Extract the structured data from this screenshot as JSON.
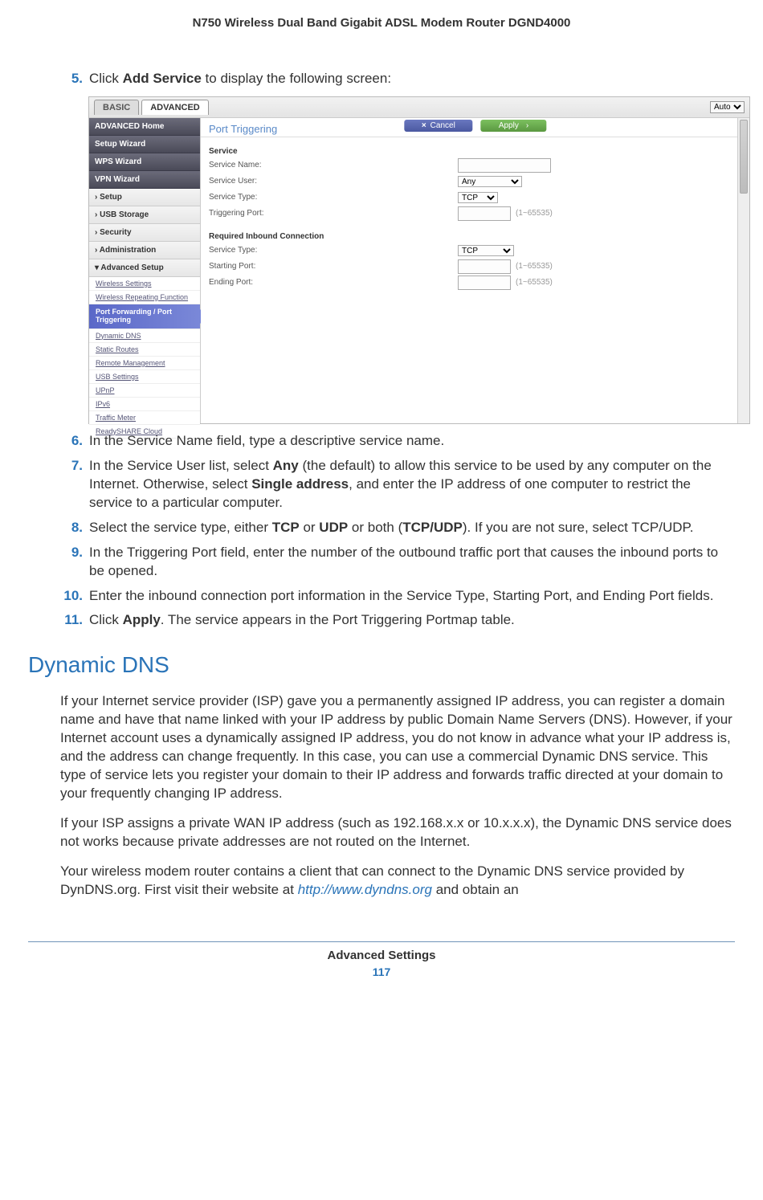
{
  "header": {
    "title": "N750 Wireless Dual Band Gigabit ADSL Modem Router DGND4000"
  },
  "steps": {
    "s5": {
      "num": "5.",
      "text_a": "Click ",
      "b1": "Add Service",
      "text_b": " to display the following screen:"
    },
    "s6": {
      "num": "6.",
      "text": "In the Service Name field, type a descriptive service name."
    },
    "s7": {
      "num": "7.",
      "a": "In the Service User list, select ",
      "b1": "Any",
      "b": " (the default) to allow this service to be used by any computer on the Internet. Otherwise, select ",
      "b2": "Single address",
      "c": ", and enter the IP address of one computer to restrict the service to a particular computer."
    },
    "s8": {
      "num": "8.",
      "a": "Select the service type, either ",
      "b1": "TCP",
      "b": " or ",
      "b2": "UDP",
      "c": " or both (",
      "b3": "TCP/UDP",
      "d": "). If you are not sure, select TCP/UDP."
    },
    "s9": {
      "num": "9.",
      "text": "In the Triggering Port field, enter the number of the outbound traffic port that causes the inbound ports to be opened."
    },
    "s10": {
      "num": "10.",
      "text": "Enter the inbound connection port information in the Service Type, Starting Port, and Ending Port fields."
    },
    "s11": {
      "num": "11.",
      "a": "Click ",
      "b1": "Apply",
      "b": ". The service appears in the Port Triggering Portmap table."
    }
  },
  "screenshot": {
    "tab_basic": "BASIC",
    "tab_advanced": "ADVANCED",
    "auto": "Auto",
    "side": {
      "home": "ADVANCED Home",
      "wiz": "Setup Wizard",
      "wps": "WPS Wizard",
      "vpn": "VPN Wizard",
      "setup": "› Setup",
      "usb": "› USB Storage",
      "sec": "› Security",
      "admin": "› Administration",
      "advsetup": "▾ Advanced Setup",
      "sub": {
        "ws": "Wireless Settings",
        "wrf": "Wireless Repeating Function",
        "pf": "Port Forwarding / Port Triggering",
        "ddns": "Dynamic DNS",
        "sr": "Static Routes",
        "rm": "Remote Management",
        "usb": "USB Settings",
        "upnp": "UPnP",
        "ipv6": "IPv6",
        "tm": "Traffic Meter",
        "cloud": "ReadySHARE Cloud"
      }
    },
    "title": "Port Triggering",
    "btn_cancel": "Cancel",
    "btn_apply": "Apply",
    "form": {
      "sec1": "Service",
      "name": "Service Name:",
      "user": "Service User:",
      "user_v": "Any",
      "type": "Service Type:",
      "type_v": "TCP",
      "trig": "Triggering Port:",
      "hint": "(1~65535)",
      "sec2": "Required Inbound Connection",
      "type2": "Service Type:",
      "type2_v": "TCP",
      "start": "Starting Port:",
      "end": "Ending Port:"
    }
  },
  "heading": "Dynamic DNS",
  "paras": {
    "p1": "If your Internet service provider (ISP) gave you a permanently assigned IP address, you can register a domain name and have that name linked with your IP address by public Domain Name Servers (DNS). However, if your Internet account uses a dynamically assigned IP address, you do not know in advance what your IP address is, and the address can change frequently. In this case, you can use a commercial Dynamic DNS service. This type of service lets you register your domain to their IP address and forwards traffic directed at your domain to your frequently changing IP address.",
    "p2": "If your ISP assigns a private WAN IP address (such as 192.168.x.x or 10.x.x.x), the Dynamic DNS service does not works because private addresses are not routed on the Internet.",
    "p3a": "Your wireless modem router contains a client that can connect to the Dynamic DNS service provided by DynDNS.org. First visit their website at ",
    "p3link": "http://www.dyndns.org",
    "p3b": " and obtain an"
  },
  "footer": {
    "section": "Advanced Settings",
    "page": "117"
  }
}
